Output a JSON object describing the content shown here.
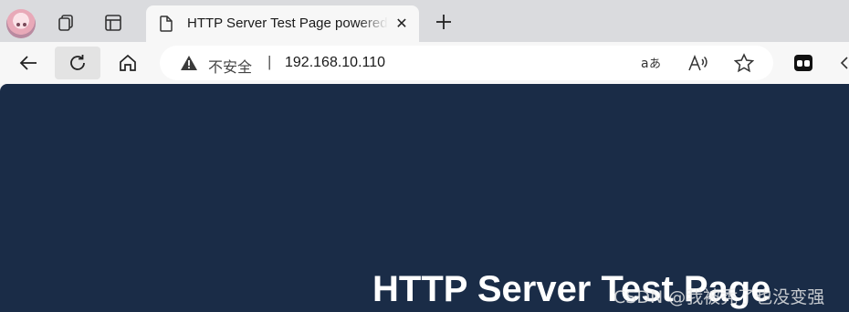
{
  "browser": {
    "tab": {
      "title": "HTTP Server Test Page powered by",
      "icon": "document-icon",
      "close_label": "✕"
    },
    "new_tab_label": "+",
    "address_bar": {
      "security_label": "不安全",
      "separator": "|",
      "url": "192.168.10.110"
    },
    "icons": [
      "profile-avatar",
      "workspaces-icon",
      "tab-actions-icon",
      "back-icon",
      "refresh-icon",
      "home-icon",
      "warning-icon",
      "translate-icon",
      "read-aloud-icon",
      "favorite-star-icon",
      "extension-icon"
    ]
  },
  "page": {
    "heading": "HTTP Server Test Page",
    "background": "#1a2c47"
  },
  "watermark": "CSDN @我被秃了也没变强"
}
